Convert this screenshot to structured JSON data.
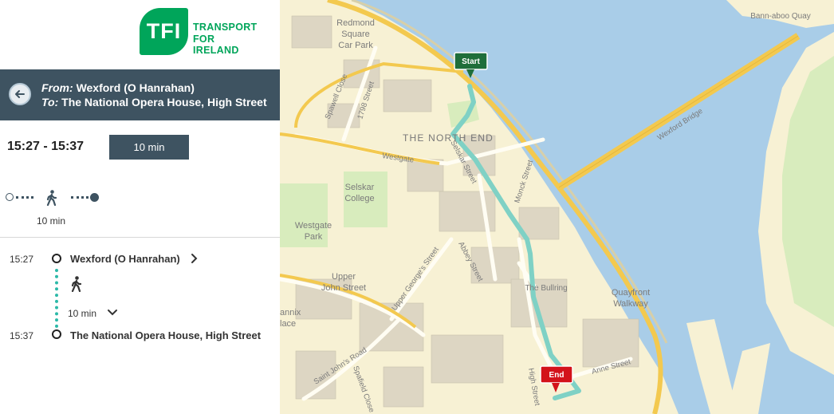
{
  "brand": {
    "badge": "TFI",
    "name_lines": [
      "TRANSPORT",
      "FOR",
      "IRELAND"
    ],
    "color": "#00a55a"
  },
  "header": {
    "from_label": "From:",
    "from_value": "Wexford (O Hanrahan)",
    "to_label": "To:",
    "to_value": "The National Opera House, High Street",
    "background": "#3e5361"
  },
  "summary": {
    "time_range": "15:27 - 15:37",
    "duration": "10 min",
    "walk_minutes": "10 min"
  },
  "legs": {
    "start_time": "15:27",
    "start_stop": "Wexford (O Hanrahan)",
    "walk_minutes": "10 min",
    "end_time": "15:37",
    "end_stop": "The National Opera House, High Street",
    "route_color": "#2cb9a8"
  },
  "map": {
    "markers": {
      "start": "Start",
      "end": "End"
    },
    "labels": {
      "redmond": [
        "Redmond",
        "Square",
        "Car Park"
      ],
      "north_end": "THE NORTH END",
      "selskar_college": [
        "Selskar",
        "College"
      ],
      "westgate_park": [
        "Westgate",
        "Park"
      ],
      "upper_john": [
        "Upper",
        "John Street"
      ],
      "annix": [
        "annix",
        "lace"
      ],
      "quayfront": [
        "Quayfront",
        "Walkway"
      ],
      "bann_aboo": "Bann-aboo Quay",
      "bullring": "The Bullring"
    },
    "streets": {
      "westgate": "Westgate",
      "selskar_street": "Selskar Street",
      "spawell_close": "Spawell Close",
      "street_1798": "1798 Street",
      "wexford_bridge": "Wexford Bridge",
      "monck_street": "Monck Street",
      "abbey_street": "Abbey Street",
      "upper_georges": "Upper George's Street",
      "saint_johns": "Saint John's Road",
      "spafield": "Spafield Close",
      "high_street": "High Street",
      "anne_street": "Anne Street"
    },
    "colors": {
      "land": "#f7f1d4",
      "water": "#a9cde8",
      "road": "#f3c94f",
      "green": "#d8ecbd",
      "route": "#7fd1c5"
    }
  }
}
